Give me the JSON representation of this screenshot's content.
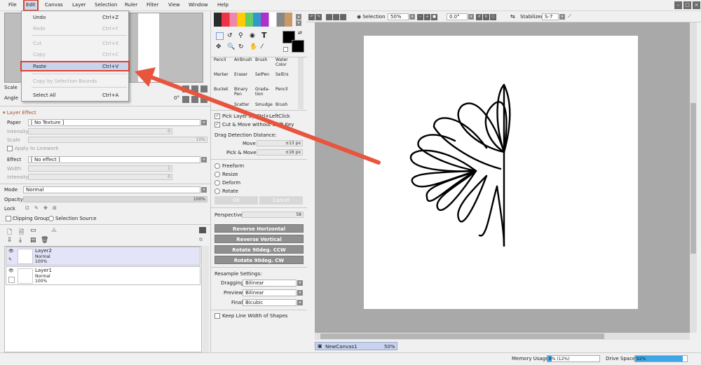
{
  "menubar": {
    "items": [
      "File",
      "Edit",
      "Canvas",
      "Layer",
      "Selection",
      "Ruler",
      "Filter",
      "View",
      "Window",
      "Help"
    ]
  },
  "window_controls": [
    "–",
    "▢",
    "×"
  ],
  "edit_menu": {
    "items": [
      {
        "label": "Undo",
        "shortcut": "Ctrl+Z",
        "enabled": true
      },
      {
        "label": "Redo",
        "shortcut": "Ctrl+Y",
        "enabled": false
      },
      {
        "label": "Cut",
        "shortcut": "Ctrl+X",
        "enabled": false
      },
      {
        "label": "Copy",
        "shortcut": "Ctrl+C",
        "enabled": false
      },
      {
        "label": "Paste",
        "shortcut": "Ctrl+V",
        "enabled": true,
        "highlighted": true
      },
      {
        "label": "Copy by Selection Bounds",
        "shortcut": "",
        "enabled": false
      },
      {
        "label": "Select All",
        "shortcut": "Ctrl+A",
        "enabled": true
      }
    ]
  },
  "navigator": {
    "scale_label": "Scale",
    "angle_label": "Angle",
    "angle_value": "0°"
  },
  "layer_effect": {
    "header": "Layer Effect",
    "paper_label": "Paper",
    "paper_value": "[ No Texture ]",
    "intensity_label": "Intensity",
    "intensity_value": "0",
    "scale_label": "Scale",
    "scale_value": "10%",
    "apply_linework": "Apply to Linework",
    "effect_label": "Effect",
    "effect_value": "[ No effect ]",
    "width_label": "Width",
    "width_value": "1",
    "intensity2_label": "Intensity",
    "intensity2_value": "0"
  },
  "layer_props": {
    "mode_label": "Mode",
    "mode_value": "Normal",
    "opacity_label": "Opacity",
    "opacity_value": "100%",
    "lock_label": "Lock",
    "clipping_group": "Clipping Group",
    "selection_source": "Selection Source"
  },
  "layers": [
    {
      "name": "Layer2",
      "mode": "Normal",
      "opacity": "100%",
      "selected": true
    },
    {
      "name": "Layer1",
      "mode": "Normal",
      "opacity": "100%",
      "selected": false
    }
  ],
  "tools": {
    "brushes": [
      [
        "Pencil",
        "AirBrush",
        "Brush",
        "Water Color"
      ],
      [
        "Marker",
        "Eraser",
        "SelPen",
        "SelErs"
      ],
      [
        "Bucket",
        "Binary Pen",
        "Grada-tion",
        "Pencil"
      ],
      [
        "",
        "Scatter",
        "Smudge",
        "Brush"
      ]
    ]
  },
  "tool_options": {
    "pick_layer": "Pick Layer by Ctrl+LeftClick",
    "cut_move": "Cut & Move without Shift Key",
    "drag_detection": "Drag Detection Distance:",
    "move_label": "Move",
    "move_value": "±13 px",
    "pick_move_label": "Pick & Move",
    "pick_move_value": "±16 px",
    "transform_modes": [
      "Freeform",
      "Resize",
      "Deform",
      "Rotate"
    ],
    "ok_label": "OK",
    "cancel_label": "Cancel",
    "perspective_label": "Perspective",
    "perspective_value": "58",
    "actions": [
      "Reverse Horizontal",
      "Reverse Vertical",
      "Rotate 90deg. CCW",
      "Rotate 90deg. CW"
    ],
    "resample_label": "Resample Settings:",
    "dragging_label": "Dragging",
    "dragging_value": "Bilinear",
    "preview_label": "Preview",
    "preview_value": "Bilinear",
    "final_label": "Final",
    "final_value": "Bicubic",
    "keep_line_width": "Keep Line Width of Shapes"
  },
  "canvas_toolbar": {
    "selection_label": "Selection",
    "zoom_value": "50%",
    "angle_value": "0.0°",
    "stabilizer_label": "Stabilizer",
    "stabilizer_value": "S-7"
  },
  "document_tab": {
    "name": "NewCanvas1",
    "zoom": "50%"
  },
  "status_bar": {
    "memory_label": "Memory Usage",
    "memory_value": "8% (12%)",
    "memory_fraction": 0.08,
    "drive_label": "Drive Space",
    "drive_value": "92%",
    "drive_fraction": 0.92
  },
  "colors": {
    "accent_red": "#e0402a",
    "highlight": "#c8d4ee",
    "canvas_bg": "#a9a9a9",
    "progress_blue": "#3da7e8"
  }
}
